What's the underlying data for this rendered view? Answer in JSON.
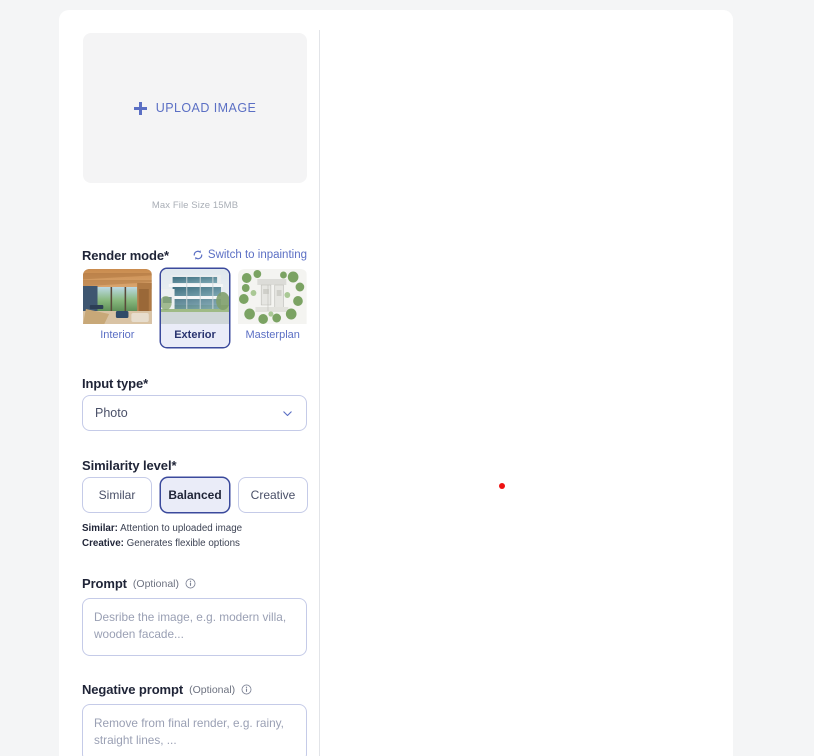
{
  "upload": {
    "button_label": "UPLOAD IMAGE",
    "plus_icon": "plus-icon",
    "max_size_note": "Max File Size 15MB"
  },
  "render_mode": {
    "title": "Render mode*",
    "switch_link_label": "Switch to inpainting",
    "switch_link_icon": "swap-refresh-icon",
    "options": [
      {
        "label": "Interior",
        "selected": false
      },
      {
        "label": "Exterior",
        "selected": true
      },
      {
        "label": "Masterplan",
        "selected": false
      }
    ]
  },
  "input_type": {
    "title": "Input type*",
    "selected_value": "Photo",
    "chevron_icon": "chevron-down-icon"
  },
  "similarity_level": {
    "title": "Similarity level*",
    "options": [
      {
        "label": "Similar",
        "selected": false
      },
      {
        "label": "Balanced",
        "selected": true
      },
      {
        "label": "Creative",
        "selected": false
      }
    ],
    "hints": [
      {
        "term": "Similar:",
        "text": " Attention to uploaded image"
      },
      {
        "term": "Creative:",
        "text": " Generates flexible options"
      }
    ]
  },
  "prompt": {
    "title": "Prompt",
    "optional_tag": "(Optional)",
    "info_icon": "info-circle-icon",
    "value": "",
    "placeholder": "Desribe the image, e.g. modern villa, wooden facade..."
  },
  "negative_prompt": {
    "title": "Negative prompt",
    "optional_tag": "(Optional)",
    "info_icon": "info-circle-icon",
    "value": "",
    "placeholder": "Remove from final render, e.g. rainy, straight lines, ..."
  },
  "canvas": {
    "marker_color": "#ee1111"
  },
  "colors": {
    "page_background": "#f4f5f6",
    "card_background": "#ffffff",
    "accent_blue": "#5b6fc4",
    "accent_dark": "#3b4a9c",
    "selected_fill": "#eaecf8",
    "border": "#c5cbe8",
    "heading": "#1f2437",
    "muted": "#a9aeb6"
  }
}
